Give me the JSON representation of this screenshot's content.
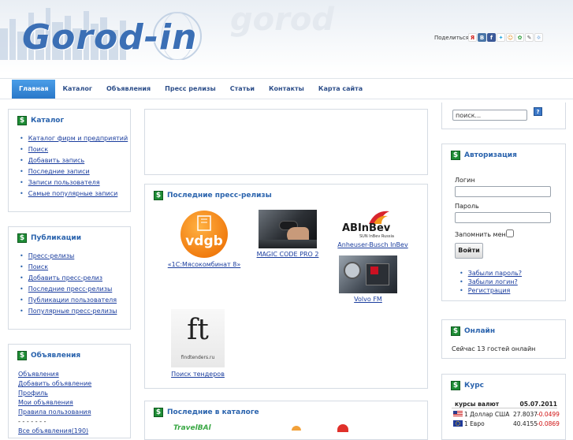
{
  "header": {
    "logo": "Gorod-in",
    "logo_ghost": "gorod",
    "share_label": "Поделиться",
    "share_icons": [
      "yandex-icon",
      "vk-icon",
      "facebook-icon",
      "twitter-icon",
      "people-icon",
      "mail-icon",
      "bookmark-icon",
      "odnoklassniki-icon"
    ]
  },
  "nav": {
    "items": [
      "Главная",
      "Каталог",
      "Объявления",
      "Пресс релизы",
      "Статьи",
      "Контакты",
      "Карта сайта"
    ],
    "active": "Главная"
  },
  "catalog": {
    "title": "Каталог",
    "items": [
      "Каталог фирм и предприятий",
      "Поиск",
      "Добавить запись",
      "Последние записи",
      "Записи пользователя",
      "Самые популярные записи"
    ]
  },
  "publications": {
    "title": "Публикации",
    "items": [
      "Пресс-релизы",
      "Поиск",
      "Добавить пресс-релиз",
      "Последние пресс-релизы",
      "Публикации пользователя",
      "Популярные пресс-релизы"
    ]
  },
  "ads": {
    "title": "Объявления",
    "items": [
      "Объявления",
      "Добавить объявление",
      "Профиль",
      "Мои объявления",
      "Правила пользования",
      "- - - - - - -",
      "Все объявления(190)"
    ]
  },
  "press": {
    "title": "Последние пресс-релизы",
    "items": [
      {
        "caption": "«1С:Мясокомбинат 8»",
        "image": "vdgb-logo"
      },
      {
        "caption": "MAGIC CODE PRO 2",
        "image": "car-key-photo"
      },
      {
        "caption": "Anheuser-Busch InBev",
        "image": "abinbev-logo",
        "logo_text": "ABInBev",
        "logo_sub": "SUN InBev Russia"
      },
      {
        "caption": "Volvo FM",
        "image": "engine-photo"
      },
      {
        "caption": "Поиск тендеров",
        "image": "findtenders-logo",
        "logo_text": "ft",
        "logo_sub": "findtenders.ru"
      }
    ],
    "vdgb_text": "vdgb"
  },
  "latest_catalog": {
    "title": "Последние в каталоге",
    "partial_text": "TravelBAl"
  },
  "search": {
    "placeholder": "поиск...",
    "value": "поиск..."
  },
  "auth": {
    "title": "Авторизация",
    "login_label": "Логин",
    "password_label": "Пароль",
    "remember_label": "Запомнить меня",
    "remember_checked": false,
    "submit_label": "Войти",
    "links": [
      "Забыли пароль?",
      "Забыли логин?",
      "Регистрация"
    ]
  },
  "online": {
    "title": "Онлайн",
    "text": "Сейчас 13 гостей онлайн"
  },
  "rates": {
    "title": "Курс",
    "header_label": "курсы валют",
    "date": "05.07.2011",
    "rows": [
      {
        "flag": "us-flag-icon",
        "label": "1 Доллар США",
        "value": "27.8037",
        "change": "-0.0499"
      },
      {
        "flag": "eu-flag-icon",
        "label": "1 Евро",
        "value": "40.4155",
        "change": "-0.0869"
      }
    ],
    "change_color": "#d01010"
  },
  "colors": {
    "accent": "#2a78c9",
    "link": "#1a3d9e",
    "title": "#2a63ad",
    "dollar_icon": "#1e8c35"
  }
}
